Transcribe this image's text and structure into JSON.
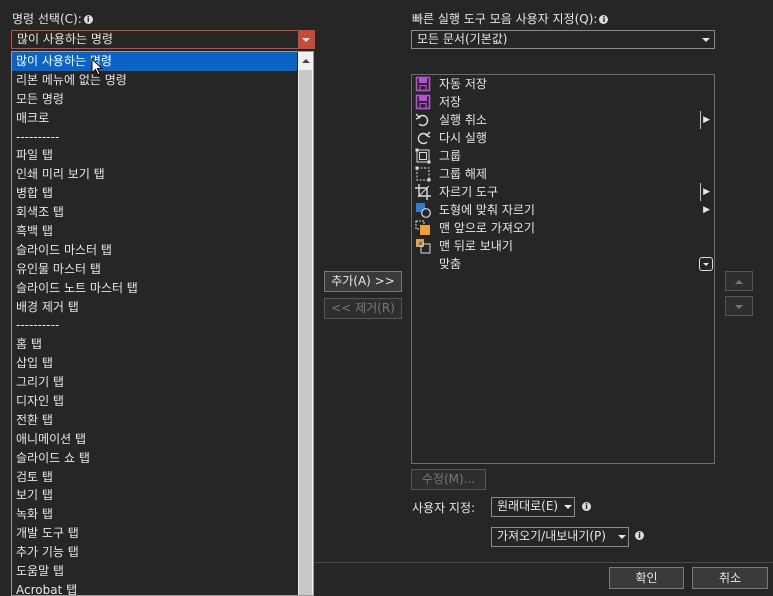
{
  "left": {
    "choose_label": "명령 선택(C):",
    "combo_value": "많이 사용하는 명령",
    "items": [
      "많이 사용하는 명령",
      "리본 메뉴에 없는 명령",
      "모든 명령",
      "매크로",
      "----------",
      "파일 탭",
      "인쇄 미리 보기 탭",
      "병합 탭",
      "회색조 탭",
      "흑백 탭",
      "슬라이드 마스터 탭",
      "유인물 마스터 탭",
      "슬라이드 노트 마스터 탭",
      "배경 제거 탭",
      "----------",
      "홈 탭",
      "삽입 탭",
      "그리기 탭",
      "디자인 탭",
      "전환 탭",
      "애니메이션 탭",
      "슬라이드 쇼 탭",
      "검토 탭",
      "보기 탭",
      "녹화 탭",
      "개발 도구 탭",
      "추가 기능 탭",
      "도움말 탭",
      "Acrobat 탭"
    ]
  },
  "middle": {
    "add_label": "추가(A) >>",
    "remove_label": "<< 제거(R)"
  },
  "right": {
    "customize_label": "빠른 실행 도구 모음 사용자 지정(Q):",
    "combo_value": "모든 문서(기본값)",
    "items": [
      {
        "label": "자동 저장",
        "icon": "autosave-icon"
      },
      {
        "label": "저장",
        "icon": "save-icon"
      },
      {
        "label": "실행 취소",
        "icon": "undo-icon"
      },
      {
        "label": "다시 실행",
        "icon": "redo-icon"
      },
      {
        "label": "그룹",
        "icon": "group-icon"
      },
      {
        "label": "그룹 해제",
        "icon": "ungroup-icon"
      },
      {
        "label": "자르기 도구",
        "icon": "crop-icon"
      },
      {
        "label": "도형에 맞춰 자르기",
        "icon": "crop-to-shape-icon"
      },
      {
        "label": "맨 앞으로 가져오기",
        "icon": "bring-to-front-icon"
      },
      {
        "label": "맨 뒤로 보내기",
        "icon": "send-to-back-icon"
      },
      {
        "label": "맞춤",
        "icon": "align-icon"
      }
    ],
    "modify_label": "수정(M)...",
    "customize_reset_label": "사용자 지정:",
    "reset_value": "원래대로(E)",
    "import_export_value": "가져오기/내보내기(P)"
  },
  "footer": {
    "ok_label": "확인",
    "cancel_label": "취소"
  },
  "colors": {
    "background": "#262626",
    "selection": "#0a64c8",
    "combo_open_border": "#c0392b",
    "icon_magenta": "#b84fd6",
    "icon_orange": "#f0a030"
  }
}
